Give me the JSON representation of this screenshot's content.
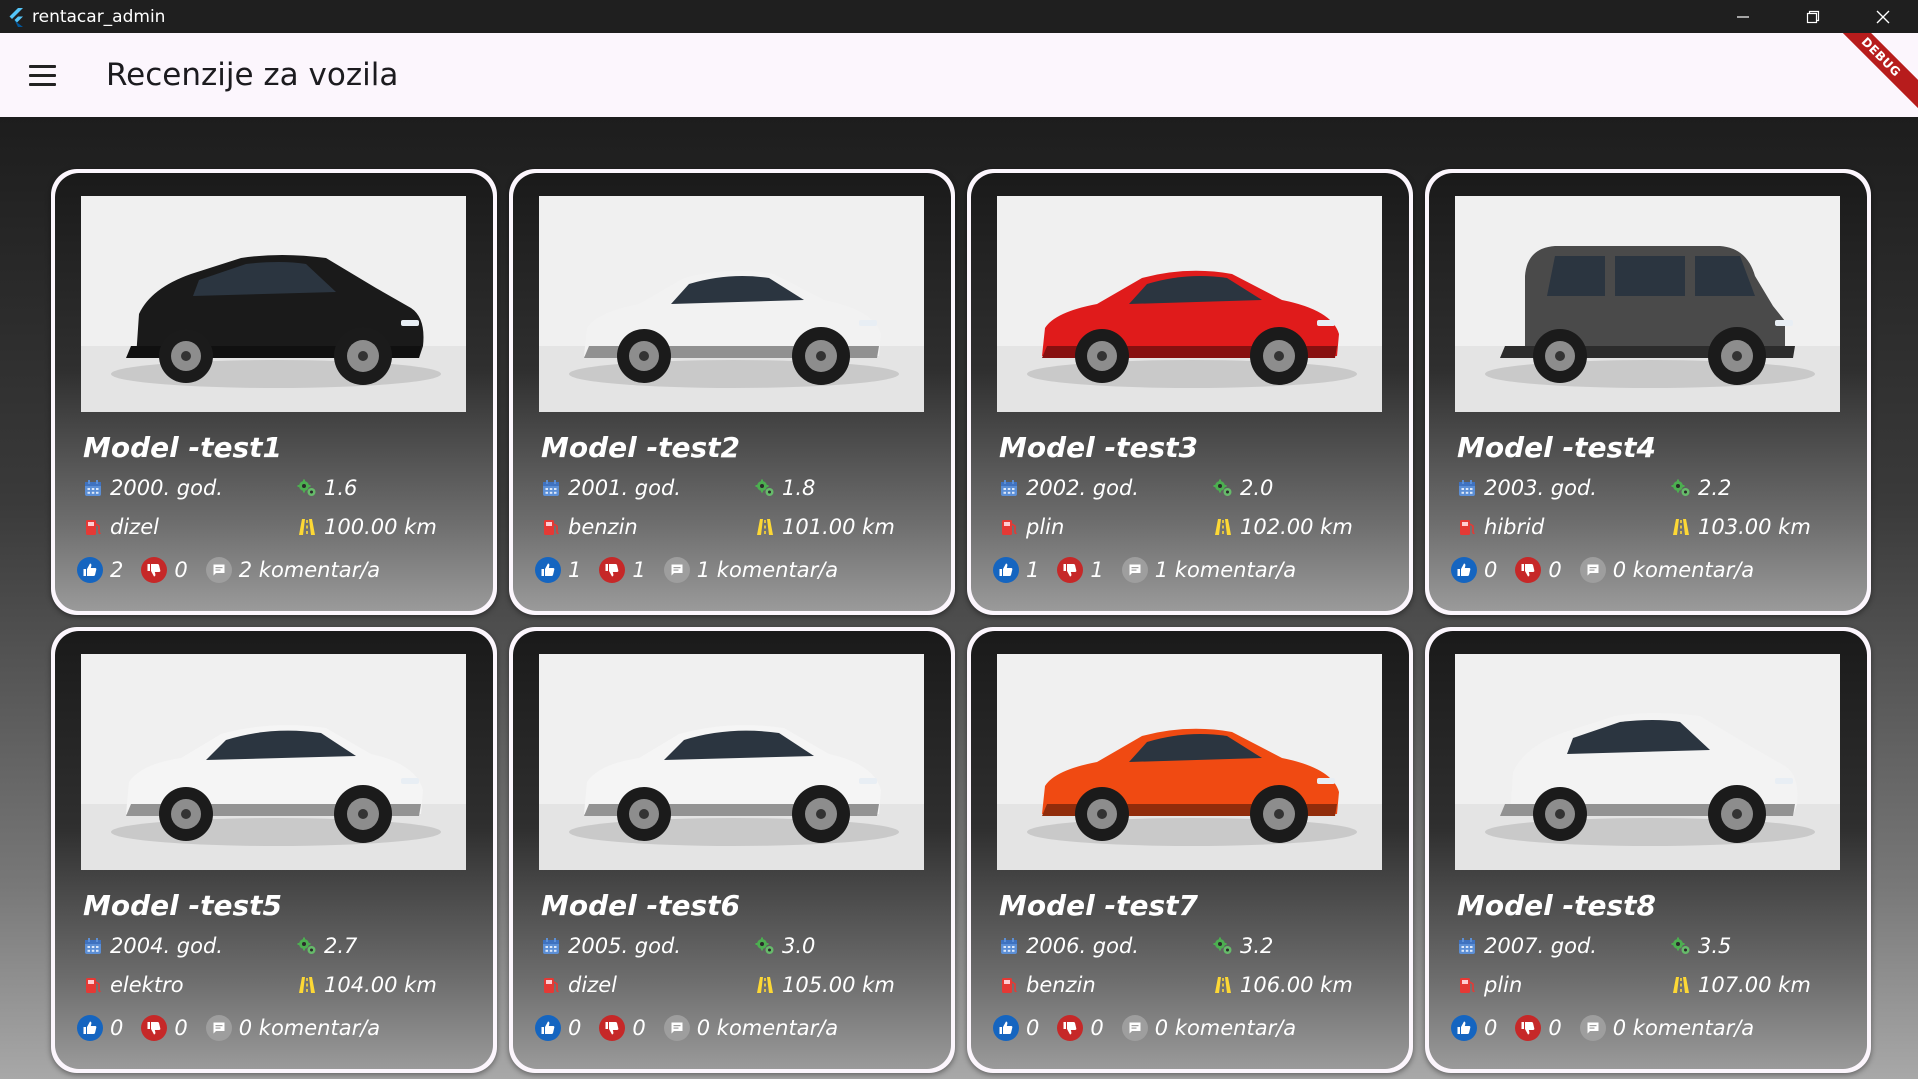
{
  "window": {
    "title": "rentacar_admin",
    "controls": [
      "minimize",
      "restore",
      "close"
    ]
  },
  "appbar": {
    "title": "Recenzije za vozila",
    "menu_icon": "hamburger-menu-icon",
    "debug_banner": "DEBUG"
  },
  "colors": {
    "like": "#1565c0",
    "dislike": "#c62828",
    "year_icon": "#5c8fd6",
    "engine_icon": "#4caf50",
    "fuel_icon": "#e53935",
    "mileage_icon": "#fdd835"
  },
  "cards": [
    {
      "model": "Model -test1",
      "year": "2000. god.",
      "engine": "1.6",
      "fuel": "dizel",
      "mileage": "100.00 km",
      "likes": "2",
      "dislikes": "0",
      "comments": "2 komentar/a",
      "car_color": "#1a1a1a",
      "car_type": "suv"
    },
    {
      "model": "Model -test2",
      "year": "2001. god.",
      "engine": "1.8",
      "fuel": "benzin",
      "mileage": "101.00 km",
      "likes": "1",
      "dislikes": "1",
      "comments": "1 komentar/a",
      "car_color": "#f2f2f2",
      "car_type": "coupe"
    },
    {
      "model": "Model -test3",
      "year": "2002. god.",
      "engine": "2.0",
      "fuel": "plin",
      "mileage": "102.00 km",
      "likes": "1",
      "dislikes": "1",
      "comments": "1 komentar/a",
      "car_color": "#e01b1b",
      "car_type": "coupe"
    },
    {
      "model": "Model -test4",
      "year": "2003. god.",
      "engine": "2.2",
      "fuel": "hibrid",
      "mileage": "103.00 km",
      "likes": "0",
      "dislikes": "0",
      "comments": "0 komentar/a",
      "car_color": "#4a4a4a",
      "car_type": "boxy"
    },
    {
      "model": "Model -test5",
      "year": "2004. god.",
      "engine": "2.7",
      "fuel": "elektro",
      "mileage": "104.00 km",
      "likes": "0",
      "dislikes": "0",
      "comments": "0 komentar/a",
      "car_color": "#f5f5f5",
      "car_type": "sedan"
    },
    {
      "model": "Model -test6",
      "year": "2005. god.",
      "engine": "3.0",
      "fuel": "dizel",
      "mileage": "105.00 km",
      "likes": "0",
      "dislikes": "0",
      "comments": "0 komentar/a",
      "car_color": "#f5f5f5",
      "car_type": "sedan"
    },
    {
      "model": "Model -test7",
      "year": "2006. god.",
      "engine": "3.2",
      "fuel": "benzin",
      "mileage": "106.00 km",
      "likes": "0",
      "dislikes": "0",
      "comments": "0 komentar/a",
      "car_color": "#f04a12",
      "car_type": "coupe"
    },
    {
      "model": "Model -test8",
      "year": "2007. god.",
      "engine": "3.5",
      "fuel": "plin",
      "mileage": "107.00 km",
      "likes": "0",
      "dislikes": "0",
      "comments": "0 komentar/a",
      "car_color": "#f3f3f3",
      "car_type": "suv"
    }
  ]
}
